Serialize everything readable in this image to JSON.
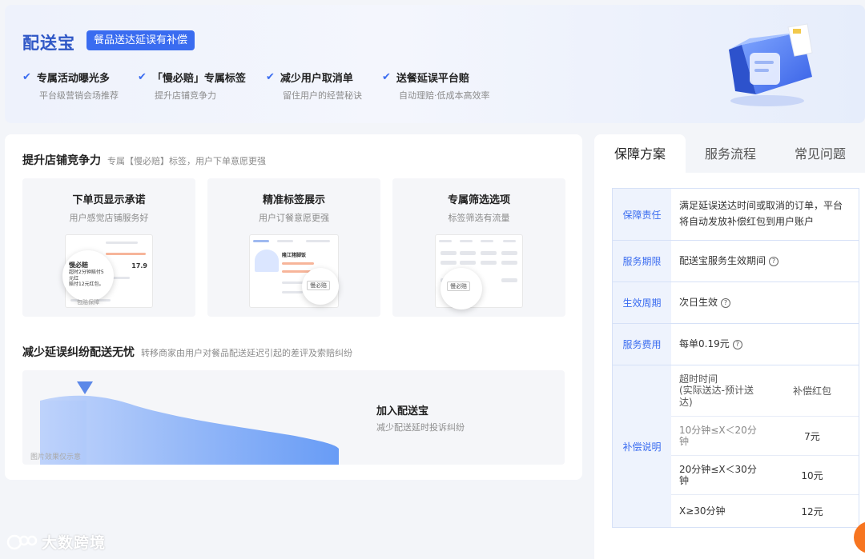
{
  "banner": {
    "logo": "配送宝",
    "tagline": "餐品送达延误有补偿",
    "features": [
      {
        "title": "专属活动曝光多",
        "sub": "平台级营销会场推荐"
      },
      {
        "title": "「慢必赔」专属标签",
        "sub": "提升店铺竞争力"
      },
      {
        "title": "减少用户取消单",
        "sub": "留住用户的经营秘诀"
      },
      {
        "title": "送餐延误平台赔",
        "sub": "自动理赔·低成本高效率"
      }
    ]
  },
  "section1": {
    "title": "提升店铺竞争力",
    "subtitle": "专属【慢必赔】标签，用户下单意愿更强",
    "tiles": [
      {
        "title": "下单页显示承诺",
        "sub": "用户感觉店铺服务好",
        "mock": {
          "badge": "慢必赔",
          "line1": "超时2分钟赔付5元红",
          "line2": "赔付12元红包。",
          "price": "17.9",
          "footer": "包赔保障"
        }
      },
      {
        "title": "精准标签展示",
        "sub": "用户订餐意愿更强",
        "mock": {
          "badge": "慢必赔",
          "brand": "隆江猪脚饭"
        }
      },
      {
        "title": "专属筛选选项",
        "sub": "标签筛选有流量",
        "mock": {
          "pill": "慢必赔"
        }
      }
    ]
  },
  "section2": {
    "title": "减少延误纠纷配送无忧",
    "subtitle": "转移商家由用户对餐品配送延迟引起的差评及索赔纠纷",
    "chart_title": "加入配送宝",
    "chart_sub": "减少配送延时投诉纠纷",
    "note": "图片效果仅示意"
  },
  "tabs": [
    {
      "label": "保障方案",
      "active": true
    },
    {
      "label": "服务流程",
      "active": false
    },
    {
      "label": "常见问题",
      "active": false
    }
  ],
  "guarantee": {
    "rows": [
      {
        "label": "保障责任",
        "value": "满足延误送达时间或取消的订单，平台将自动发放补偿红包到用户账户"
      },
      {
        "label": "服务期限",
        "value": "配送宝服务生效期间"
      },
      {
        "label": "生效周期",
        "value": "次日生效"
      },
      {
        "label": "服务费用",
        "value": "每单0.19元"
      }
    ],
    "compensation": {
      "label": "补偿说明",
      "header": {
        "time": "超时时间\n(实际送达-预计送达)",
        "amount": "补偿红包"
      },
      "rows": [
        {
          "time": "10分钟≤X＜20分钟",
          "amount": "7元"
        },
        {
          "time": "20分钟≤X＜30分钟",
          "amount": "10元"
        },
        {
          "time": "X≥30分钟",
          "amount": "12元"
        }
      ]
    }
  },
  "watermark": "大数跨境",
  "icons": [
    "check-icon",
    "help-circle-icon",
    "delivery-bag-illustration",
    "watermark-logo-icon"
  ],
  "colors": {
    "accent": "#3a6cf0",
    "brand": "#2f57c6",
    "label_bg": "#eef3fd",
    "floating_button": "#f77520"
  }
}
